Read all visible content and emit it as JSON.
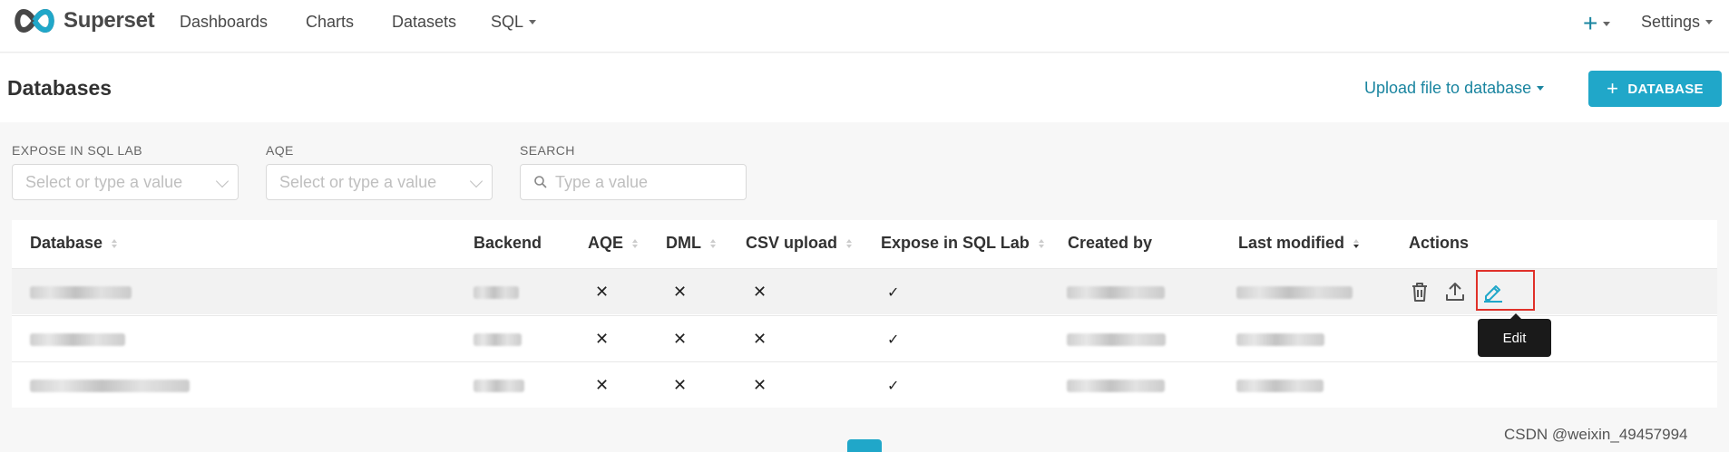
{
  "brand": {
    "name": "Superset"
  },
  "nav": {
    "items": [
      {
        "label": "Dashboards"
      },
      {
        "label": "Charts"
      },
      {
        "label": "Datasets"
      },
      {
        "label": "SQL"
      }
    ],
    "right": {
      "add_symbol": "+",
      "settings_label": "Settings"
    }
  },
  "page": {
    "title": "Databases",
    "upload_label": "Upload file to database",
    "add_button_label": "DATABASE",
    "add_button_symbol": "+"
  },
  "filters": [
    {
      "label": "EXPOSE IN SQL LAB",
      "placeholder": "Select or type a value"
    },
    {
      "label": "AQE",
      "placeholder": "Select or type a value"
    },
    {
      "label": "SEARCH",
      "placeholder": "Type a value"
    }
  ],
  "table": {
    "columns": [
      {
        "label": "Database"
      },
      {
        "label": "Backend"
      },
      {
        "label": "AQE"
      },
      {
        "label": "DML"
      },
      {
        "label": "CSV upload"
      },
      {
        "label": "Expose in SQL Lab"
      },
      {
        "label": "Created by"
      },
      {
        "label": "Last modified"
      },
      {
        "label": "Actions"
      }
    ],
    "rows": [
      {
        "aqe": "✕",
        "dml": "✕",
        "csv": "✕",
        "expose": "✓"
      },
      {
        "aqe": "✕",
        "dml": "✕",
        "csv": "✕",
        "expose": "✓"
      },
      {
        "aqe": "✕",
        "dml": "✕",
        "csv": "✕",
        "expose": "✓"
      }
    ]
  },
  "tooltip": {
    "edit": "Edit"
  },
  "watermark": "CSDN @weixin_49457994",
  "colors": {
    "accent": "#20a7c9",
    "link": "#1a85a0",
    "highlight": "#e0312a"
  }
}
